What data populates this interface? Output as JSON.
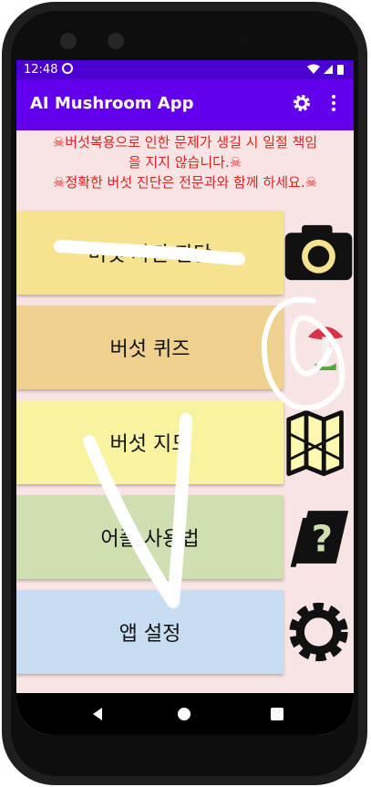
{
  "status": {
    "time": "12:48"
  },
  "app": {
    "title": "AI Mushroom App"
  },
  "warning": {
    "line1": "☠버섯복용으로 인한 문제가 생길 시 일절 책임",
    "line2": "을 지지 않습니다.☠",
    "line3": "☠정확한 버섯 진단은 전문과와 함께 하세요.☠"
  },
  "menu": [
    {
      "label": "버섯 사진 판단",
      "icon": "camera-icon",
      "color": "#f6e38f"
    },
    {
      "label": "버섯 퀴즈",
      "icon": "mushroom-icon",
      "color": "#edd18d"
    },
    {
      "label": "버섯 지도",
      "icon": "map-icon",
      "color": "#f7f3a0"
    },
    {
      "label": "어플 사용법",
      "icon": "help-book-icon",
      "color": "#cfdfb1"
    },
    {
      "label": "앱 설정",
      "icon": "settings-gear-icon",
      "color": "#c6ddf2"
    }
  ],
  "colors": {
    "statusbar": "#4b00d1",
    "appbar": "#6200ee",
    "warning_text": "#e0221e",
    "background": "#f8e4e4"
  }
}
